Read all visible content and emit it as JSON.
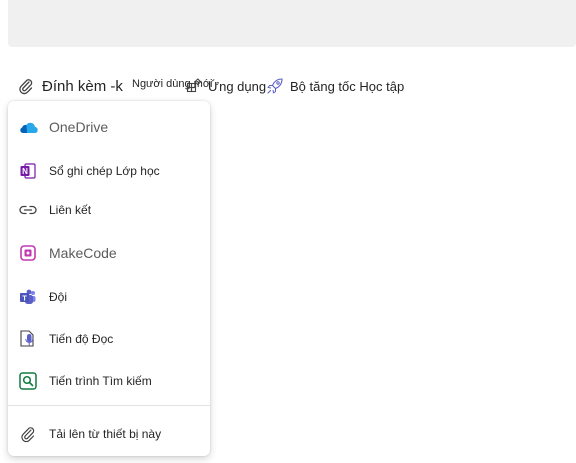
{
  "toolbar": {
    "attach_label": "Đính kèm -k",
    "new_user_label": "Người dùng mới",
    "apps_label": "Ứng dụng",
    "booster_label": "Bộ tăng tốc Học tập"
  },
  "attach_menu": {
    "items": [
      {
        "label": "OneDrive",
        "icon": "onedrive-icon"
      },
      {
        "label": "Sổ ghi chép Lớp học",
        "icon": "onenote-class-notebook-icon"
      },
      {
        "label": "Liên kết",
        "icon": "link-icon"
      },
      {
        "label": "MakeCode",
        "icon": "makecode-icon"
      },
      {
        "label": "Đội",
        "icon": "teams-icon"
      },
      {
        "label": "Tiến độ Đọc",
        "icon": "reading-progress-icon"
      },
      {
        "label": "Tiến trình Tìm kiếm",
        "icon": "search-progress-icon"
      },
      {
        "label": "Tải lên từ thiết bị này",
        "icon": "paperclip-icon"
      }
    ]
  },
  "colors": {
    "onedrive": "#0364b8",
    "onenote": "#7719aa",
    "makecode": "#c239b3",
    "teams": "#5b5fc7",
    "search_progress": "#107c41"
  }
}
